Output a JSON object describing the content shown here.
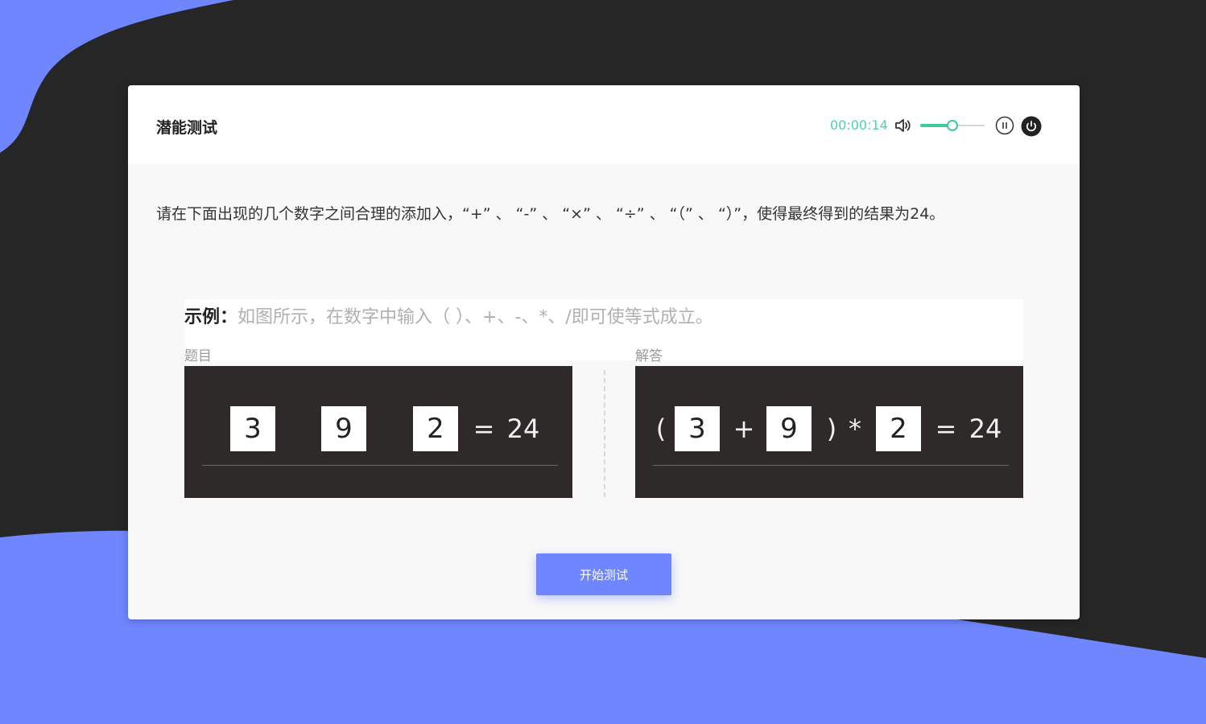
{
  "colors": {
    "background_dark": "#262626",
    "background_blue": "#6f86ff",
    "accent_green": "#3cc99b",
    "timer_text": "#4cd3a8",
    "panel_dark": "#2e2a2a"
  },
  "header": {
    "title": "潜能测试",
    "timer": "00:00:14",
    "volume_icon": "speaker-icon",
    "volume_level_percent": 50,
    "pause_icon": "pause-circle-icon",
    "power_icon": "power-icon"
  },
  "instruction": "请在下面出现的几个数字之间合理的添加入，“+” 、 “-” 、 “×” 、 “÷” 、 “（” 、 “）”，使得最终得到的结果为24。",
  "example": {
    "label": "示例：",
    "text": "如图所示，在数字中输入（ ）、+、-、*、/即可使等式成立。",
    "question_label": "题目",
    "answer_label": "解答",
    "question": {
      "numbers": [
        "3",
        "9",
        "2"
      ],
      "equals": "=",
      "result": "24"
    },
    "answer": {
      "open_paren": "(",
      "numbers": [
        "3",
        "9",
        "2"
      ],
      "op1": "+",
      "close_paren": ")",
      "op2": "*",
      "equals": "=",
      "result": "24"
    }
  },
  "start_button": "开始测试"
}
